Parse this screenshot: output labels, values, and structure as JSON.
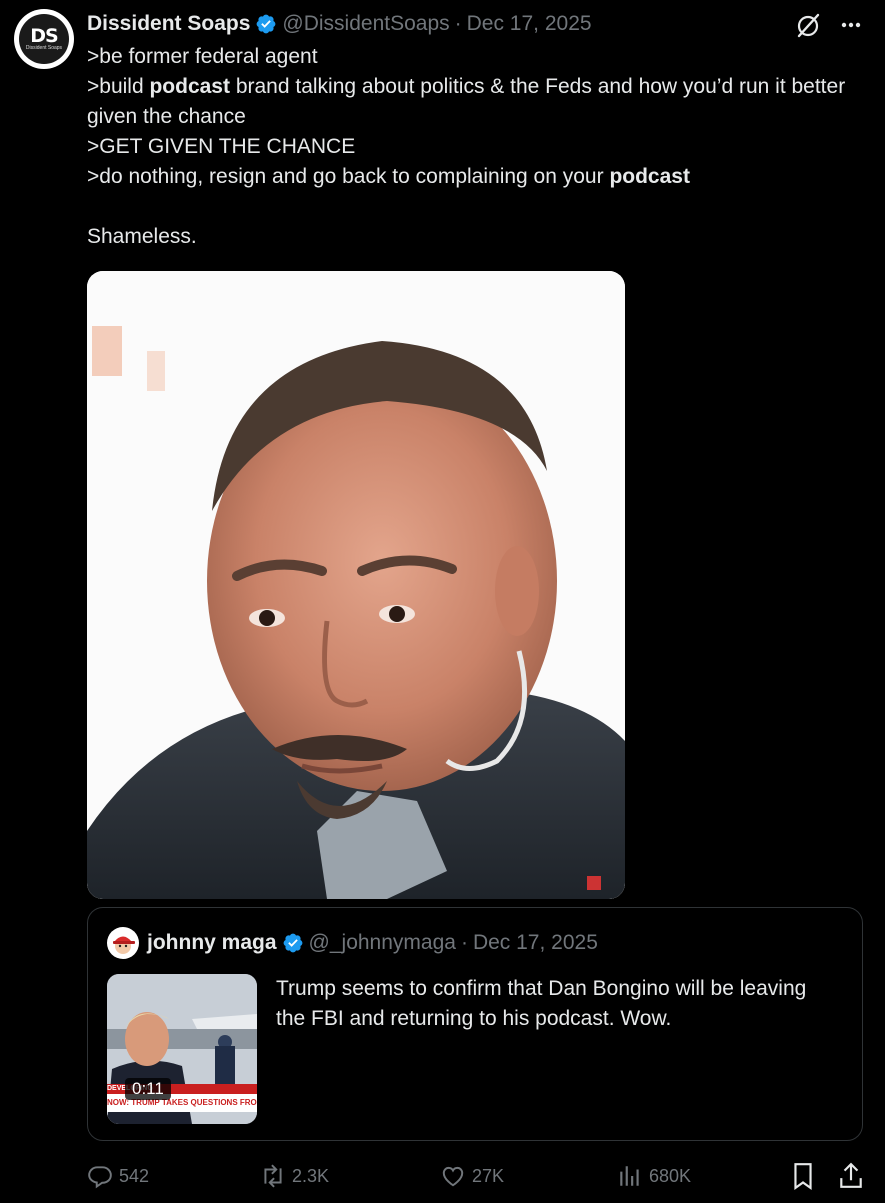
{
  "author": {
    "name": "Dissident Soaps",
    "handle": "@DissidentSoaps",
    "separator": "·",
    "date": "Dec 17, 2025",
    "avatar_text": "DS",
    "avatar_subtext": "Dissident Soaps"
  },
  "tweet": {
    "line1": ">be former federal agent",
    "line2_pre": ">build ",
    "line2_bold": "podcast",
    "line2_post": " brand talking about politics & the Feds and how you’d run it better given the chance",
    "line3": ">GET GIVEN THE CHANCE",
    "line4_pre": ">do nothing, resign and go back to complaining on your ",
    "line4_bold": "podcast",
    "line5": "Shameless."
  },
  "quote": {
    "name": "johnny maga",
    "handle": "@_johnnymaga",
    "separator": "·",
    "date": "Dec 17, 2025",
    "text": "Trump seems to confirm that Dan Bongino will be leaving the FBI and returning to his podcast. Wow.",
    "video_duration": "0:11",
    "video_banner": "NOW: TRUMP TAKES QUESTIONS FROM REPORTERS",
    "video_banner_tag": "DEVELOPING"
  },
  "actions": {
    "replies": "542",
    "reposts": "2.3K",
    "likes": "27K",
    "views": "680K"
  },
  "colors": {
    "background": "#000000",
    "text": "#e7e9ea",
    "muted": "#71767b",
    "verified": "#1d9bf0",
    "border": "#2f3336"
  },
  "icons": [
    "grok-icon",
    "more-icon",
    "verified-badge-icon",
    "reply-icon",
    "repost-icon",
    "like-icon",
    "views-icon",
    "bookmark-icon",
    "share-icon"
  ]
}
